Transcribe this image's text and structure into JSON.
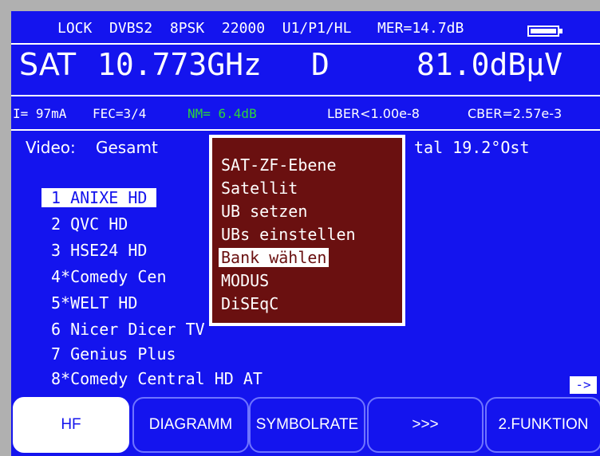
{
  "status": {
    "line1": "LOCK  DVBS2  8PSK  22000  U1/P1/HL   MER=14.7dB",
    "band": "SAT",
    "frequency": "10.773GHz",
    "polarity": "D",
    "level": "81.0dBµV",
    "current": "I= 97mA",
    "fec": "FEC=3/4",
    "nm": "NM= 6.4dB",
    "lber": "LBER<1.00e-8",
    "cber": "CBER=2.57e-3"
  },
  "info": {
    "video_label": "Video:",
    "video_value": "Gesamt",
    "sat_value": "tal 19.2°Ost"
  },
  "channels": [
    "1 ANIXE HD",
    "2 QVC HD",
    "3 HSE24 HD",
    "4*Comedy Cen",
    "5*WELT HD",
    "6 Nicer Dicer TV",
    "7 Genius Plus",
    "8*Comedy Central HD AT"
  ],
  "popup_menu": [
    "SAT-ZF-Ebene",
    "Satellit",
    "UB setzen",
    "UBs einstellen",
    "Bank wählen",
    "MODUS",
    "DiSEqC"
  ],
  "scroll_arrow": "->",
  "function_keys": [
    "HF",
    "DIAGRAMM",
    "SYMBOLRATE",
    ">>>",
    "2.FUNKTION"
  ],
  "colors": {
    "screen_bg": "#1414ee",
    "popup_bg": "#6a1010",
    "nm_green": "#2bd43b",
    "text": "#ffffff"
  }
}
